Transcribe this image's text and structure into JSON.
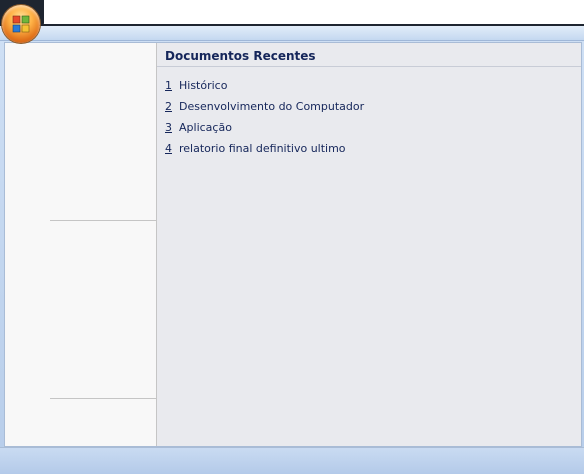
{
  "menu": {
    "recent_documents_title": "Documentos Recentes",
    "recent_documents": [
      {
        "number": "1",
        "name": "Histórico"
      },
      {
        "number": "2",
        "name": "Desenvolvimento do Computador"
      },
      {
        "number": "3",
        "name": "Aplicação"
      },
      {
        "number": "4",
        "name": "relatorio final definitivo ultimo"
      }
    ]
  },
  "icons": {
    "office_button": "office-logo-icon"
  },
  "colors": {
    "text": "#15265a",
    "frame": "#b7cdea",
    "right_pane": "#e9eaee"
  }
}
